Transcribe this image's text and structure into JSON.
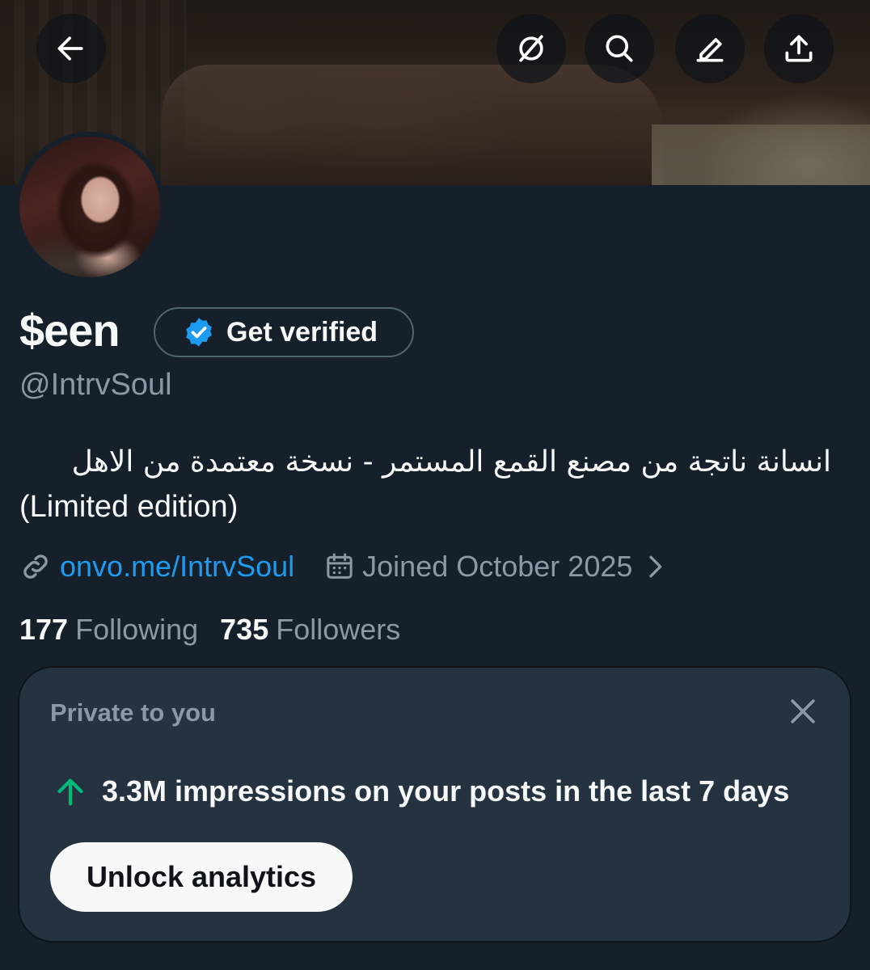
{
  "header": {
    "back": "back-arrow-icon",
    "actions": [
      "grok-icon",
      "search-icon",
      "edit-icon",
      "share-icon"
    ]
  },
  "profile": {
    "display_name": "$een",
    "verify_label": "Get verified",
    "handle": "@IntrvSoul",
    "bio_arabic": "انسانة ناتجة من مصنع القمع المستمر - نسخة معتمدة من الاهل",
    "bio_english": "(Limited edition)",
    "link": "onvo.me/IntrvSoul",
    "joined": "Joined October 2025",
    "following_count": "177",
    "following_label": "Following",
    "followers_count": "735",
    "followers_label": "Followers"
  },
  "private_card": {
    "title": "Private to you",
    "stat": "3.3M impressions on your posts in the last 7 days",
    "button_label": "Unlock analytics"
  },
  "colors": {
    "background": "#15202b",
    "card": "#253341",
    "link": "#1d9bf0",
    "muted": "#8b98a5",
    "up_arrow": "#00ba7c"
  }
}
